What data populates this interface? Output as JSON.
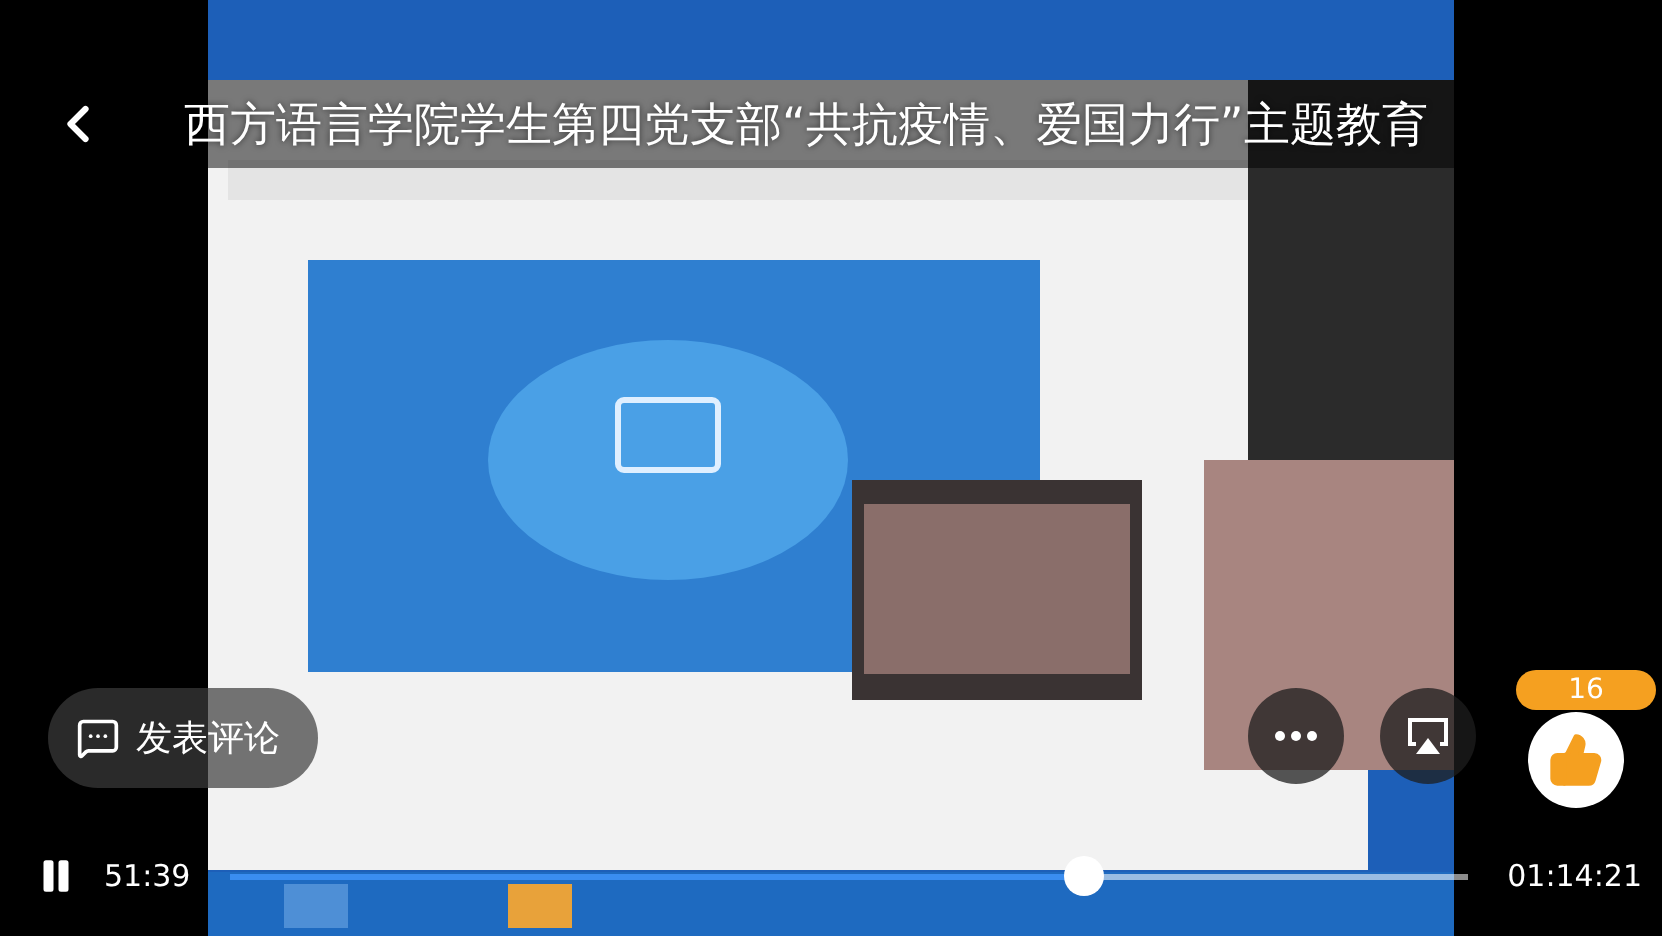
{
  "header": {
    "title": "西方语言学院学生第四党支部“共抗疫情、爱国力行”主题教育"
  },
  "comment_button": {
    "label": "发表评论"
  },
  "like": {
    "count": "16"
  },
  "player": {
    "playing": true,
    "elapsed": "51:39",
    "duration": "01:14:21",
    "level": 0.69
  }
}
